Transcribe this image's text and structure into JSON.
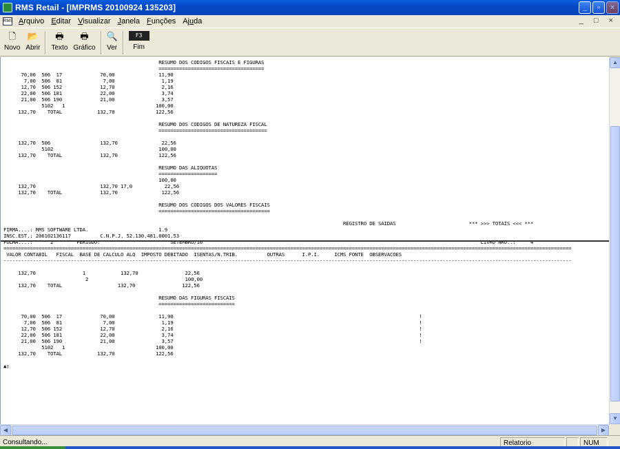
{
  "window": {
    "title": "RMS Retail - [IMPRMS 20100924 135203]",
    "buttons": [
      "_",
      "□",
      "×"
    ]
  },
  "menu": {
    "items": [
      {
        "underline": "A",
        "rest": "rquivo"
      },
      {
        "underline": "E",
        "rest": "ditar"
      },
      {
        "underline": "V",
        "rest": "isualizar"
      },
      {
        "underline": "J",
        "rest": "anela"
      },
      {
        "underline": "F",
        "rest": "unções"
      },
      {
        "pre": "Aj",
        "underline": "u",
        "rest": "da"
      }
    ],
    "mdi_controls": "_ □ ×"
  },
  "toolbar": {
    "novo": "Novo",
    "abrir": "Abrir",
    "texto": "Texto",
    "grafico": "Gráfico",
    "ver": "Ver",
    "fim": "Fim",
    "fim_key": "F3"
  },
  "report": {
    "lines": [
      "                                                     RESUMO DOS CODIGOS FISCAIS E FIGURAS",
      "                                                     ====================================",
      "      70,00  506  17             70,00               11,90",
      "       7,00  506  81              7,00                1,19",
      "      12,70  506 152             12,70                2,16",
      "      22,00  506 181             22,00                3,74",
      "      21,00  506 190             21,00                3,57",
      "             5102   1                               100,00",
      "     132,70    TOTAL            132,70              122,56",
      "",
      "                                                     RESUMO DOS CODIGOS DE NATUREZA FISCAL",
      "                                                     =====================================",
      "",
      "     132,70  506                 132,70               22,56",
      "             5102                                    100,00",
      "     132,70    TOTAL             132,70              122,56",
      "",
      "                                                     RESUMO DAS ALIQUOTAS",
      "                                                     ====================",
      "                                                     100,00",
      "     132,70                      132,70 17,0           22,56",
      "     132,70    TOTAL             132,70               122,56",
      "",
      "                                                     RESUMO DOS CODIGOS DOS VALORES FISCAIS",
      "                                                     ======================================",
      "",
      "                                                                                                                    REGISTRO DE SAIDAS                         *** >>> TOTAIS <<< ***",
      "FIRMA....: RMS SOFTWARE LTDA.                        1.9",
      "INSC.EST.: 206102136117          C.N.P.J. 52.130.481.0001.53",
      "FOLHA....:      2        PERIODO:                        SETEMBRO/10                                                                                               LIVRO NRO..:     4",
      "==================================================================================================================================================================================================",
      " VALOR CONTABIL   FISCAL  BASE DE CALCULO ALQ  IMPOSTO DEBITADO  ISENTAS/N.TRIB.          OUTRAS      I.P.I.     ICMS FONTE  OBSERVACOES",
      "--------------------------------------------------------------------------------------------------------------------------------------------------------------------------------------------------",
      "",
      "     132,70                1            132,70                22,56",
      "                            2                                 100,00",
      "     132,70    TOTAL                   132,70                122,56",
      "",
      "                                                     RESUMO DAS FIGURAS FISCAIS",
      "                                                     ==========================",
      "",
      "      70,00  506  17             70,00               11,90                                                                                    !",
      "       7,00  506  81              7,00                1,19                                                                                    !",
      "      12,70  506 152             12,70                2,16                                                                                    !",
      "      22,00  506 181             22,00                3,74                                                                                    !",
      "      21,00  506 190             21,00                3,57                                                                                    !",
      "             5102   1                               100,00",
      "     132,70    TOTAL            132,70              122,56",
      "",
      "▲▯"
    ]
  },
  "status": {
    "message": "Consultando...",
    "panel_relatorio": "Relatorio",
    "panel_empty": "",
    "panel_num": "NUM"
  }
}
